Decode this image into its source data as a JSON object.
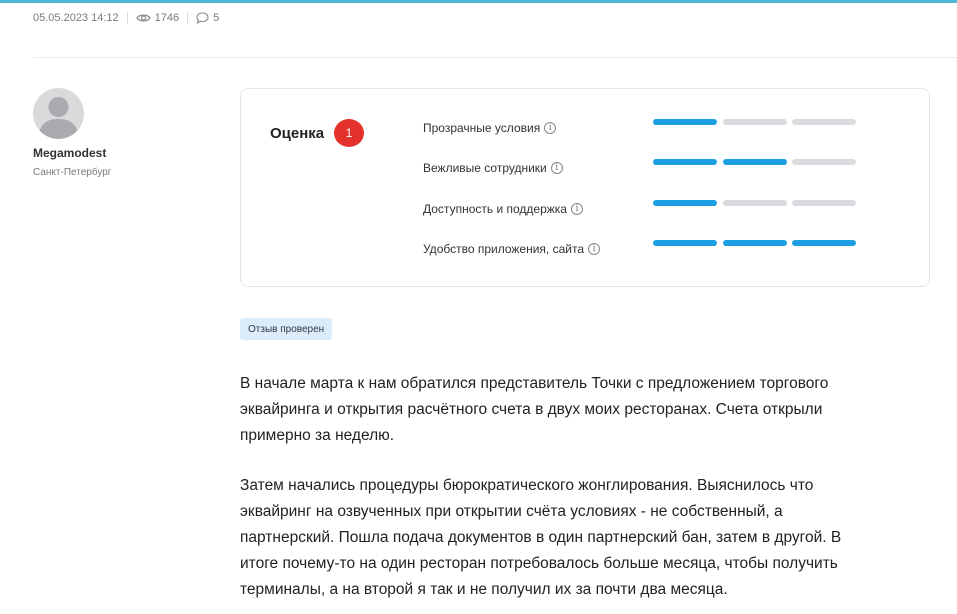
{
  "meta": {
    "date": "05.05.2023 14:12",
    "views": "1746",
    "comments": "5"
  },
  "author": {
    "name": "Megamodest",
    "city": "Санкт-Петербург"
  },
  "rating": {
    "title": "Оценка",
    "score": "1",
    "criteria": [
      {
        "label": "Прозрачные условия",
        "value": 1,
        "max": 3
      },
      {
        "label": "Вежливые сотрудники",
        "value": 2,
        "max": 3
      },
      {
        "label": "Доступность и поддержка",
        "value": 1,
        "max": 3
      },
      {
        "label": "Удобство приложения, сайта",
        "value": 3,
        "max": 3
      }
    ],
    "info_icon": "i"
  },
  "badge": "Отзыв проверен",
  "review": {
    "p1": [
      "В начале марта к нам обратился представитель Точки с предложением торгового",
      "эквайринга и открытия расчётного счета в двух моих ресторанах. Счета открыли",
      "примерно за неделю."
    ],
    "p2": [
      "Затем начались процедуры бюрократического жонглирования. Выяснилось что",
      "эквайринг на озвученных при открытии счёта условиях - не собственный, а",
      "партнерский. Пошла подача документов в один партнерский бан, затем в другой. В",
      "итоге почему-то на один ресторан потребовалось больше месяца, чтобы получить",
      "терминалы, а на второй я так и не получил их за почти два месяца."
    ]
  },
  "colors": {
    "accent": "#1c9ee0",
    "inactive": "#d9dbde",
    "badge_red": "#e4312b",
    "topline": "#4fb8d9"
  },
  "icons": {
    "views": "eye-icon",
    "comments": "comment-icon",
    "info": "info-icon",
    "avatar": "user-avatar-placeholder"
  }
}
